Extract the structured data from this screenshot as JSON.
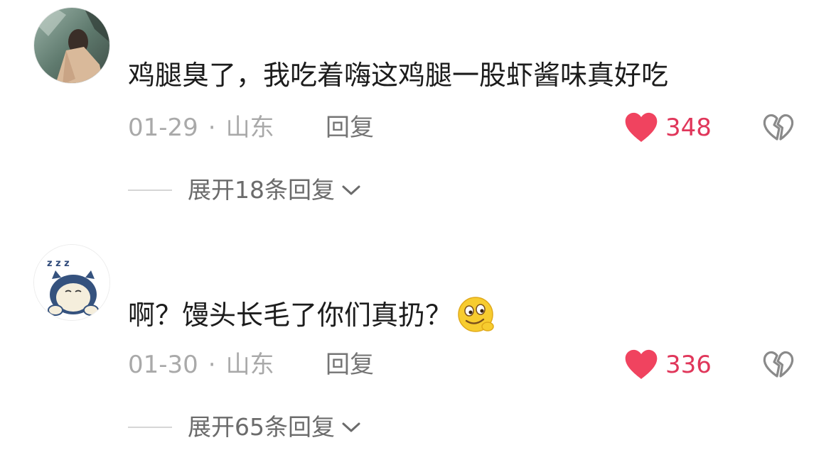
{
  "comments": [
    {
      "avatar_icon": "user-photo-avatar",
      "text": "鸡腿臭了，我吃着嗨这鸡腿一股虾酱味真好吃",
      "date": "01-29",
      "separator": "·",
      "location": "山东",
      "reply_label": "回复",
      "like_count": "348",
      "expand_label": "展开18条回复"
    },
    {
      "avatar_icon": "sleeping-cartoon-avatar",
      "text": "啊？馒头长毛了你们真扔？",
      "emoji_icon": "smirk-emoji-icon",
      "date": "01-30",
      "separator": "·",
      "location": "山东",
      "reply_label": "回复",
      "like_count": "336",
      "expand_label": "展开65条回复"
    }
  ],
  "colors": {
    "like": "#f0435f",
    "like_count": "#e0365a",
    "meta": "#a9a9a9",
    "text": "#1c1c1c"
  },
  "icons": {
    "like": "heart-icon",
    "dislike": "broken-heart-icon",
    "expand": "chevron-down-icon"
  }
}
